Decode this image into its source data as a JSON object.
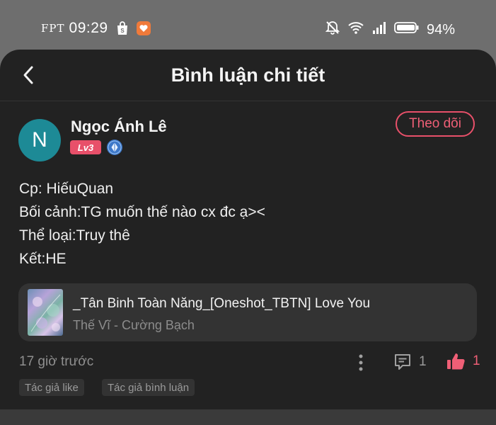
{
  "status_bar": {
    "carrier": "FPT",
    "time": "09:29",
    "battery": "94%"
  },
  "header": {
    "title": "Bình luận chi tiết"
  },
  "comment": {
    "author": {
      "avatar_letter": "N",
      "name": "Ngọc Ánh Lê",
      "level": "Lv3"
    },
    "follow_label": "Theo dõi",
    "lines": [
      "Cp: HiếuQuan",
      "Bối cảnh:TG muốn thế nào cx đc ạ><",
      "Thể loại:Truy thê",
      "Kết:HE"
    ],
    "book": {
      "title": "_Tân Binh Toàn Năng_[Oneshot_TBTN] Love You",
      "author": "Thế Vĩ - Cường Bạch"
    },
    "time_ago": "17 giờ trước",
    "reply_count": "1",
    "like_count": "1",
    "tags": [
      "Tác giả like",
      "Tác giả bình luận"
    ]
  },
  "colors": {
    "accent": "#e8506a",
    "avatar_bg": "#1d8a96",
    "sheet_bg": "#222222",
    "card_bg": "#333333"
  }
}
